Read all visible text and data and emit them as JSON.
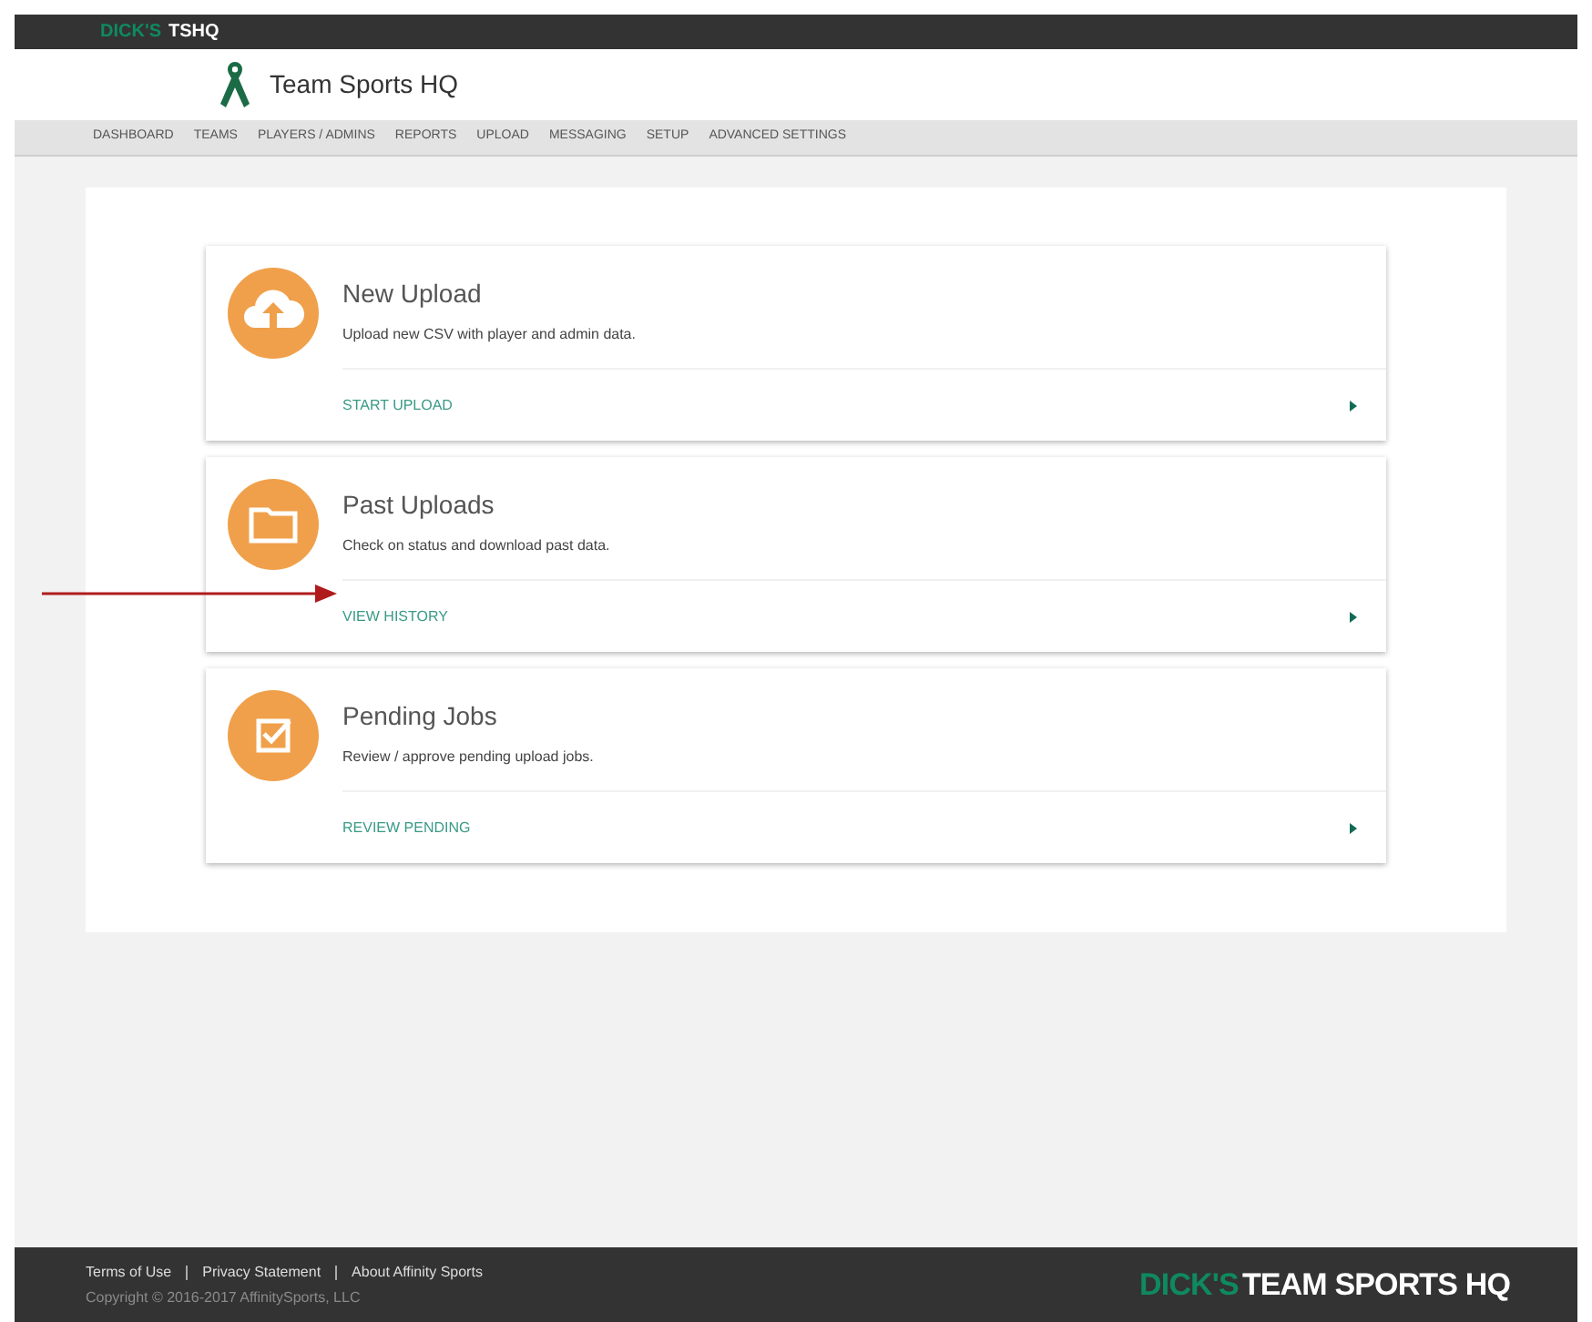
{
  "top_bar": {
    "brand_mark": "DICK'S",
    "brand": "TSHQ"
  },
  "header": {
    "title": "Team Sports HQ"
  },
  "nav": [
    {
      "label": "DASHBOARD"
    },
    {
      "label": "TEAMS"
    },
    {
      "label": "PLAYERS / ADMINS"
    },
    {
      "label": "REPORTS"
    },
    {
      "label": "UPLOAD"
    },
    {
      "label": "MESSAGING"
    },
    {
      "label": "SETUP"
    },
    {
      "label": "ADVANCED SETTINGS"
    }
  ],
  "cards": [
    {
      "kind": "upload",
      "title": "New Upload",
      "description": "Upload new CSV with player and admin data.",
      "action": "START UPLOAD",
      "annotated": false
    },
    {
      "kind": "folder",
      "title": "Past Uploads",
      "description": "Check on status and download past data.",
      "action": "VIEW HISTORY",
      "annotated": true
    },
    {
      "kind": "check",
      "title": "Pending Jobs",
      "description": "Review / approve pending upload jobs.",
      "action": "REVIEW PENDING",
      "annotated": false
    }
  ],
  "footer": {
    "links": [
      "Terms of Use",
      "Privacy Statement",
      "About Affinity Sports"
    ],
    "copyright": "Copyright © 2016-2017 AffinitySports, LLC",
    "logo_mark": "DICK'S",
    "logo": "TEAM SPORTS HQ"
  }
}
